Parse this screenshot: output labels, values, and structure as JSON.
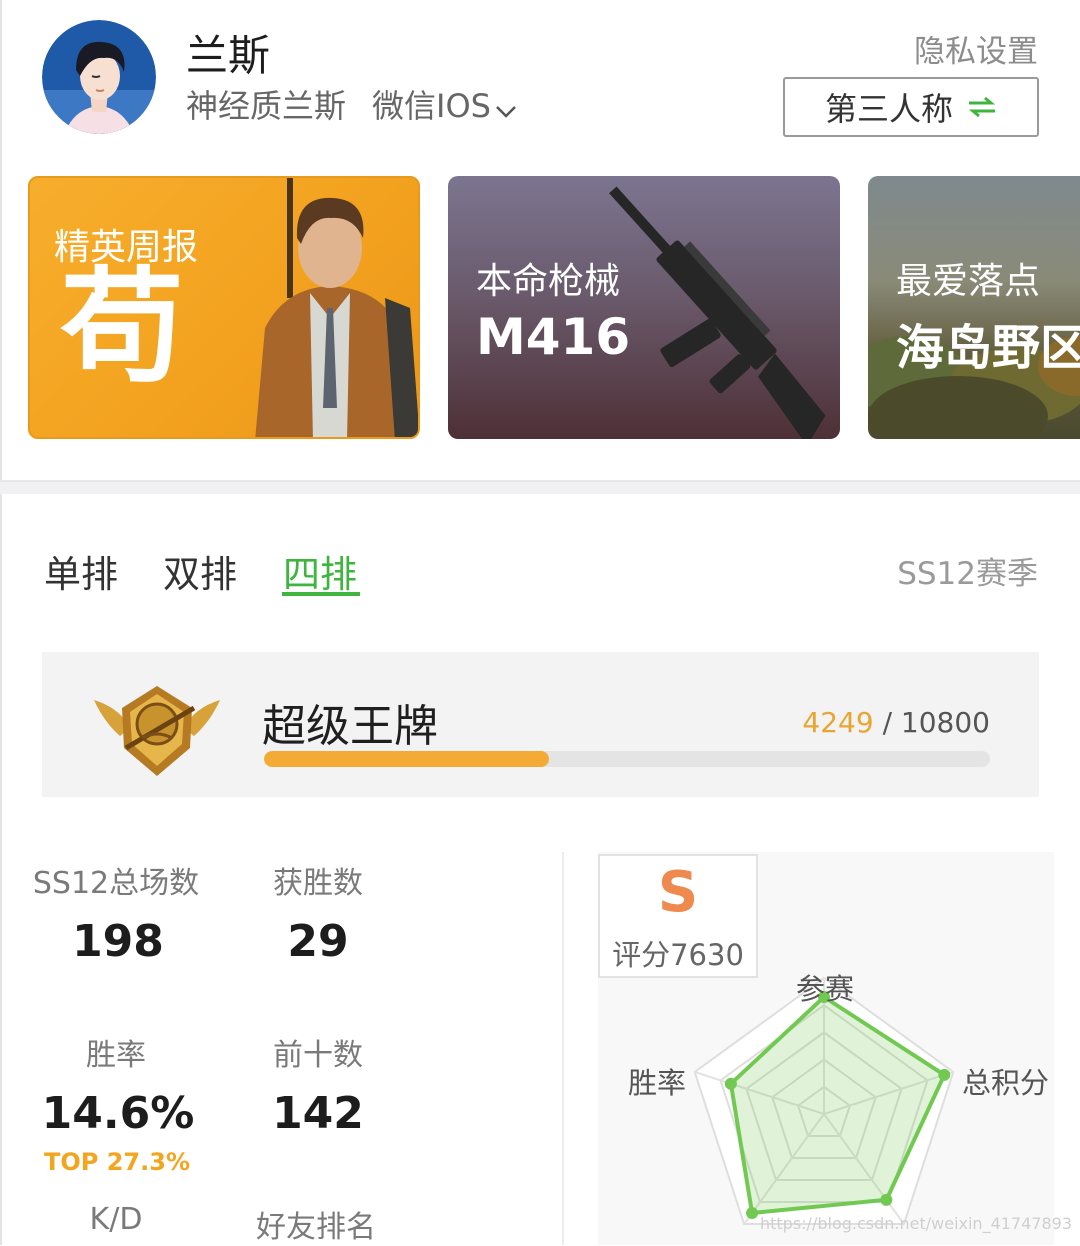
{
  "header": {
    "user_name": "兰斯",
    "nickname": "神经质兰斯",
    "platform": "微信IOS",
    "privacy_link": "隐私设置",
    "view_toggle_label": "第三人称"
  },
  "cards": {
    "elite": {
      "label": "精英周报",
      "value": "苟"
    },
    "weapon": {
      "label": "本命枪械",
      "value": "M416"
    },
    "drop": {
      "label": "最爱落点",
      "value": "海岛野区"
    }
  },
  "tabs": [
    {
      "label": "单排",
      "active": false
    },
    {
      "label": "双排",
      "active": false
    },
    {
      "label": "四排",
      "active": true
    }
  ],
  "season": "SS12赛季",
  "rank": {
    "name": "超级王牌",
    "current": "4249",
    "separator": "/",
    "target": "10800",
    "progress_fraction": 0.393
  },
  "stats": [
    {
      "label": "SS12总场数",
      "value": "198"
    },
    {
      "label": "获胜数",
      "value": "29"
    },
    {
      "label": "胜率",
      "value": "14.6%",
      "sub": "TOP 27.3%"
    },
    {
      "label": "前十数",
      "value": "142"
    },
    {
      "label": "K/D",
      "value": ""
    },
    {
      "label": "好友排名",
      "value": ""
    }
  ],
  "grade": {
    "letter": "S",
    "score_text": "评分7630"
  },
  "radar": {
    "labels": {
      "top": "参赛",
      "right": "总积分",
      "left": "胜率"
    },
    "values": [
      0.86,
      0.93,
      0.78,
      0.9,
      0.72
    ]
  },
  "colors": {
    "accent_green": "#3fb43f",
    "accent_orange": "#f3ab35",
    "grade_orange": "#ee8a4e",
    "radar_green": "#72c952"
  },
  "watermark": "https://blog.csdn.net/weixin_41747893"
}
